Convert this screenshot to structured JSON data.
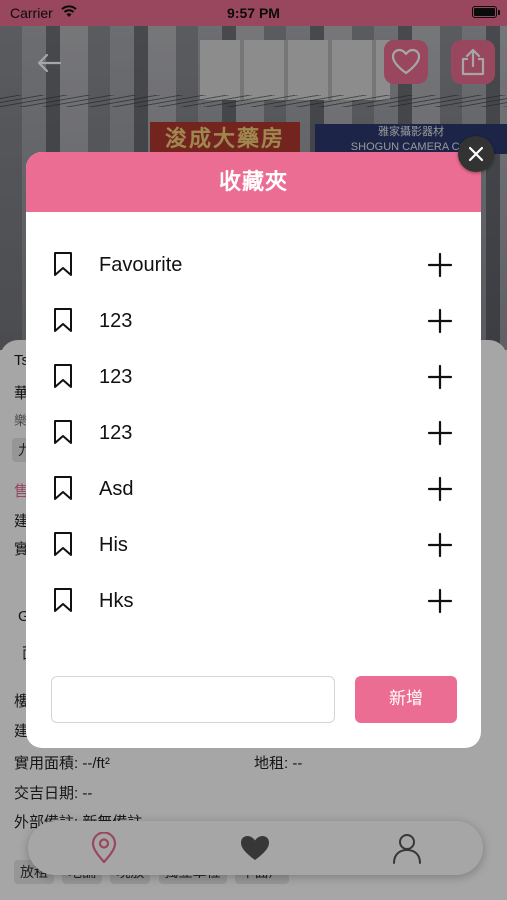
{
  "status_bar": {
    "carrier": "Carrier",
    "time": "9:57 PM"
  },
  "hero": {
    "sign_left": "浚成大藥房",
    "sign_right_line1": "雅家攝影器材",
    "sign_right_line2": "SHOGUN CAMERA CO."
  },
  "detail": {
    "line1": "Ts",
    "line2": "華",
    "line3": "樂",
    "line4": "九",
    "line5_pink": "售",
    "line6": "建",
    "line7": "實",
    "line8": "G",
    "line9": "面",
    "line10": "樓",
    "line11": "建",
    "area_label": "實用面積: --/ft²",
    "ground_rent": "地租: --",
    "deal_date": "交吉日期: --",
    "remarks": "外部備註: 新無備註",
    "tags": [
      "放租",
      "地舖",
      "現放",
      "獨立單位",
      "平面戶"
    ]
  },
  "tabbar": {
    "items": [
      "map-pin-icon",
      "heart-icon",
      "user-icon"
    ]
  },
  "modal": {
    "title": "收藏夾",
    "folders": [
      {
        "name": "Favourite"
      },
      {
        "name": "123"
      },
      {
        "name": "123"
      },
      {
        "name": "123"
      },
      {
        "name": "Asd"
      },
      {
        "name": "His"
      },
      {
        "name": "Hks"
      }
    ],
    "new_input_value": "",
    "new_input_placeholder": "",
    "new_button_label": "新增"
  },
  "colors": {
    "accent": "#ec6d93",
    "overlay": "rgba(0,0,0,0.35)",
    "close_button": "#333333"
  }
}
